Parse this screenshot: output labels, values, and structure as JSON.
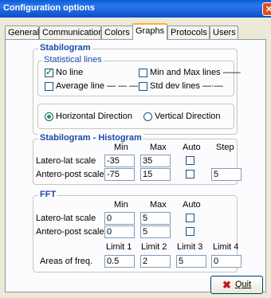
{
  "window": {
    "title": "Configuration options",
    "close_glyph": "✕"
  },
  "tabs": [
    {
      "label": "General"
    },
    {
      "label": "Communication"
    },
    {
      "label": "Colors"
    },
    {
      "label": "Graphs",
      "active": true
    },
    {
      "label": "Protocols"
    },
    {
      "label": "Users"
    }
  ],
  "stabilogram": {
    "title": "Stabilogram",
    "statistical_lines": {
      "title": "Statistical lines",
      "no_line": {
        "label": "No line",
        "checked": true
      },
      "min_max": {
        "label": "Min and Max lines ——",
        "checked": false
      },
      "average": {
        "label": "Average line — — —",
        "checked": false
      },
      "std_dev": {
        "label": "Std dev lines —·—",
        "checked": false
      }
    },
    "direction": {
      "horizontal": {
        "label": "Horizontal Direction",
        "selected": true
      },
      "vertical": {
        "label": "Vertical Direction",
        "selected": false
      }
    }
  },
  "histogram": {
    "title": "Stabilogram - Histogram",
    "col_min": "Min",
    "col_max": "Max",
    "col_auto": "Auto",
    "col_step": "Step",
    "latero": {
      "label": "Latero-lat scale",
      "min": "-35",
      "max": "35",
      "auto": false
    },
    "antero": {
      "label": "Antero-post scale",
      "min": "-75",
      "max": "15",
      "auto": false,
      "step": "5"
    }
  },
  "fft": {
    "title": "FFT",
    "col_min": "Min",
    "col_max": "Max",
    "col_auto": "Auto",
    "latero": {
      "label": "Latero-lat scale",
      "min": "0",
      "max": "5",
      "auto": false
    },
    "antero": {
      "label": "Antero-post scale",
      "min": "0",
      "max": "5",
      "auto": false
    },
    "limits": {
      "label": "Areas of freq.",
      "h1": "Limit 1",
      "h2": "Limit 2",
      "h3": "Limit 3",
      "h4": "Limit 4",
      "v1": "0.5",
      "v2": "2",
      "v3": "5",
      "v4": "0"
    }
  },
  "quit": {
    "label": "Quit",
    "icon": "x-icon"
  }
}
